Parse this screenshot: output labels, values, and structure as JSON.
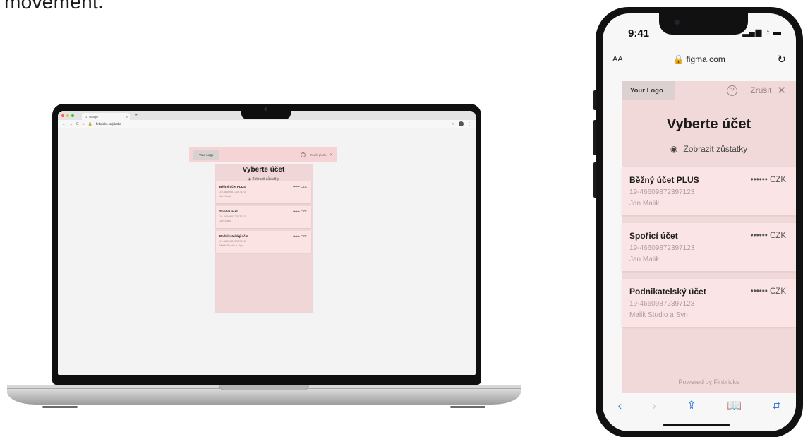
{
  "intro_text": "movement.",
  "laptop": {
    "browser": {
      "tab_title": "Google",
      "new_tab": "+",
      "url": "finbricks.cz/platba"
    },
    "header": {
      "logo": "Your Logo",
      "help": "?",
      "cancel": "Zrušit platbu",
      "close": "✕"
    },
    "title": "Vyberte účet",
    "toggle": "Zobrazit zůstatky",
    "accounts": [
      {
        "name": "Běžný účet PLUS",
        "balance": "•••••• CZK",
        "number": "19-466098723971​23",
        "owner": "Jan Malík"
      },
      {
        "name": "Spořicí účet",
        "balance": "•••••• CZK",
        "number": "19-466098723971​23",
        "owner": "Jan Malík"
      },
      {
        "name": "Podnikatelský účet",
        "balance": "•••••• CZK",
        "number": "19-466098723971​23",
        "owner": "Malík Studio a Syn"
      }
    ]
  },
  "phone": {
    "status": {
      "time": "9:41",
      "signal": "▂▄▆ ◔ ▬"
    },
    "address": {
      "aa": "AA",
      "url": "🔒 figma.com",
      "reload": "↻"
    },
    "header": {
      "logo": "Your Logo",
      "help": "?",
      "cancel": "Zrušit",
      "close": "✕"
    },
    "title": "Vyberte účet",
    "toggle": "Zobrazit zůstatky",
    "accounts": [
      {
        "name": "Běžný účet PLUS",
        "balance": "•••••• CZK",
        "number": "19-46609872397123",
        "owner": "Jan Malik"
      },
      {
        "name": "Spořicí účet",
        "balance": "•••••• CZK",
        "number": "19-46609872397123",
        "owner": "Jan Malik"
      },
      {
        "name": "Podnikatelský účet",
        "balance": "•••••• CZK",
        "number": "19-46609872397123",
        "owner": "Malik Studio a Syn"
      }
    ],
    "powered": "Powered by Finbricks",
    "toolbar": {
      "back": "‹",
      "forward": "›",
      "share": "⇪",
      "bookmarks": "📖",
      "tabs": "⧉"
    }
  }
}
